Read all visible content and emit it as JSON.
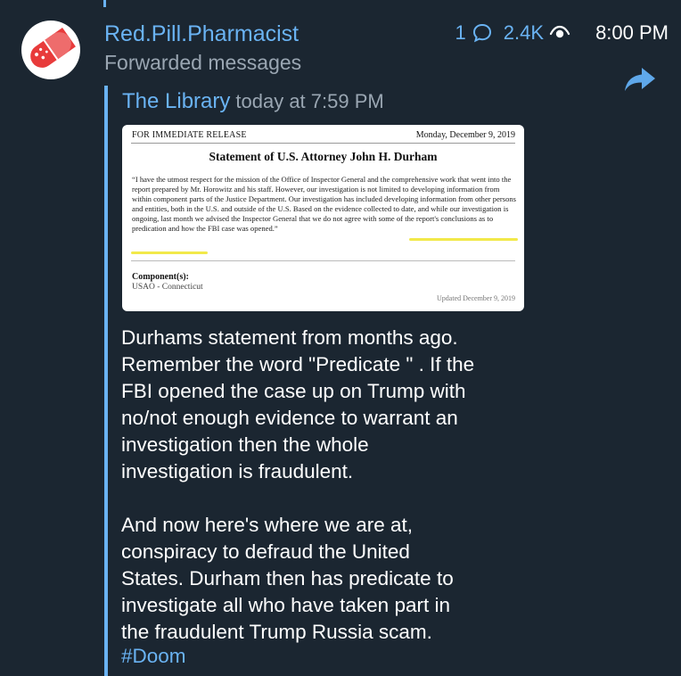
{
  "message": {
    "sender": "Red.Pill.Pharmacist",
    "reply_count": "1",
    "views": "2.4K",
    "time": "8:00 PM",
    "forwarded_label": "Forwarded messages"
  },
  "forward": {
    "source_name": "The Library",
    "source_time": "today at 7:59 PM"
  },
  "document": {
    "release": "FOR IMMEDIATE RELEASE",
    "date": "Monday, December 9, 2019",
    "title": "Statement of U.S. Attorney John H. Durham",
    "body": "“I have the utmost respect for the mission of the Office of Inspector General and the comprehensive work that went into the report prepared by Mr. Horowitz and his staff.  However, our investigation is not limited to developing information from within component parts of the Justice Department.  Our investigation has included developing information from other persons and entities, both in the U.S. and outside of the U.S.  Based on the evidence collected to date, and while our investigation is ongoing, last month we advised the Inspector General that we do not agree with some of the report's conclusions as to predication and how the FBI case was opened.”",
    "component_label": "Component(s):",
    "component_value": "USAO - Connecticut",
    "updated": "Updated December 9, 2019"
  },
  "text": {
    "body": "Durhams statement from months ago.\nRemember the word \"Predicate \" . If the\nFBI opened the case up on Trump with\nno/not enough evidence to warrant an\ninvestigation then the whole\ninvestigation is fraudulent.\n\nAnd now here's where we are at,\nconspiracy to defraud the United\nStates.  Durham then has predicate to\ninvestigate all who have taken part in\nthe fraudulent Trump Russia scam.",
    "hashtag": "#Doom"
  },
  "colors": {
    "background": "#1b2631",
    "accent": "#6ab3f3",
    "muted": "#9aa6b2",
    "highlight": "#f2e94a",
    "pill_red": "#e83b3b"
  },
  "icons": [
    "pill-avatar-icon",
    "reply-bubble-icon",
    "eye-icon",
    "share-arrow-icon"
  ]
}
